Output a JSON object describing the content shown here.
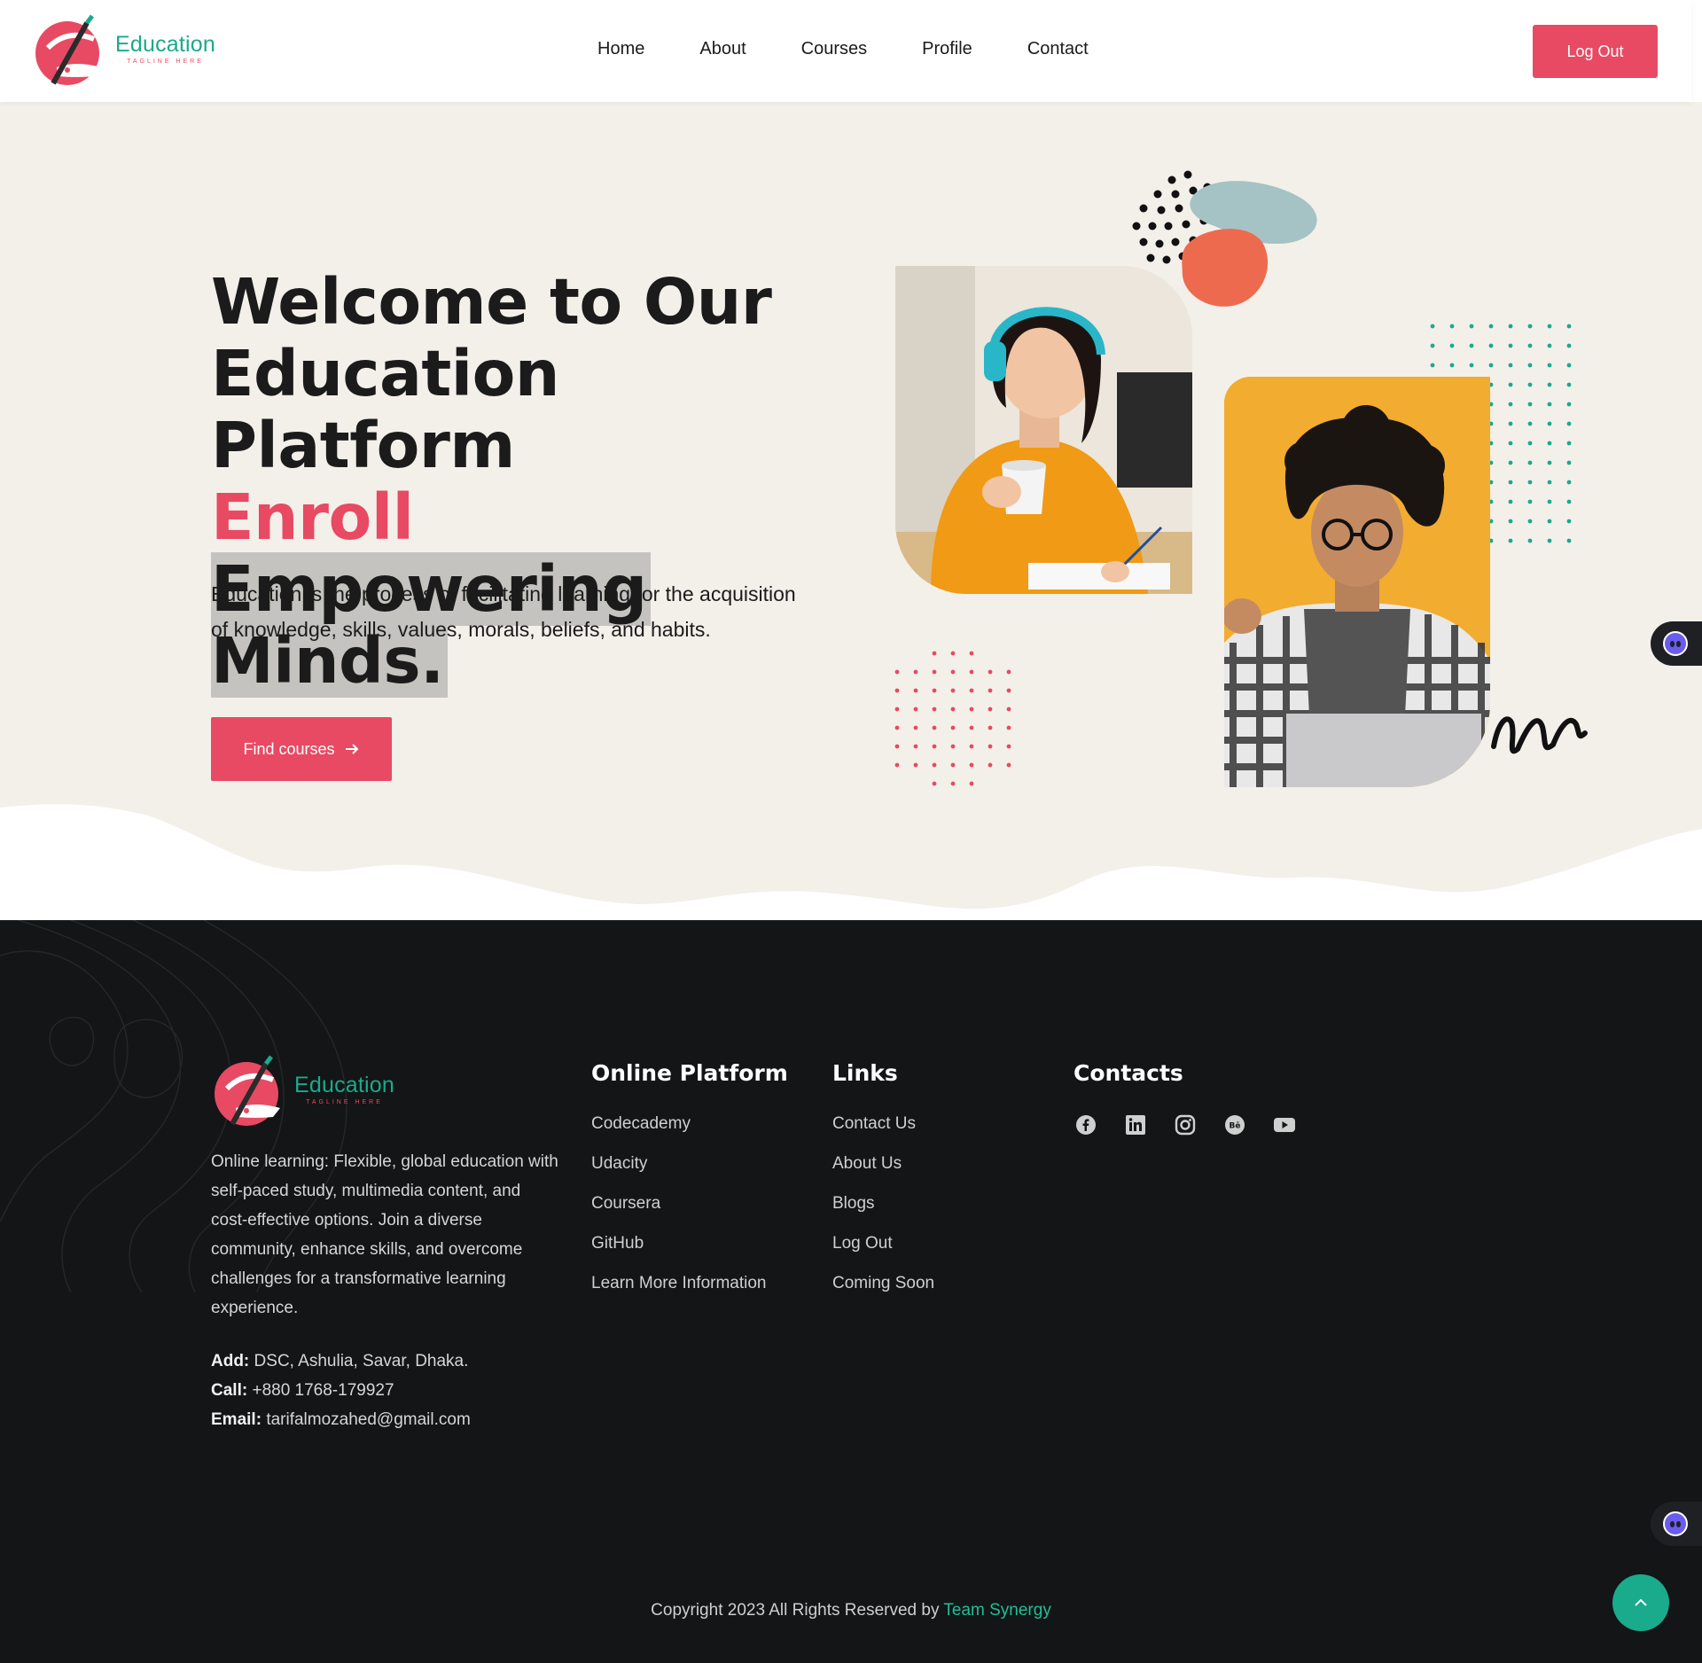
{
  "header": {
    "brand": {
      "name": "Education",
      "tagline": "TAGLINE HERE"
    },
    "nav": [
      {
        "label": "Home"
      },
      {
        "label": "About"
      },
      {
        "label": "Courses"
      },
      {
        "label": "Profile"
      },
      {
        "label": "Contact"
      }
    ],
    "logout_label": "Log Out"
  },
  "hero": {
    "title_line1": "Welcome to Our",
    "title_line2": "Education Platform",
    "title_pink": "Enroll",
    "title_highlight_1": "Empowering",
    "title_highlight_2": "Minds.",
    "description": "Education is the process of facilitating learning, or the acquisition of knowledge, skills, values, morals, beliefs, and habits.",
    "cta_label": "Find courses"
  },
  "footer": {
    "brand": {
      "name": "Education",
      "tagline": "TAGLINE HERE"
    },
    "description": "Online learning: Flexible, global education with self-paced study, multimedia content, and cost-effective options. Join a diverse community, enhance skills, and overcome challenges for a transformative learning experience.",
    "address_label": "Add:",
    "address": "DSC, Ashulia, Savar, Dhaka.",
    "call_label": "Call:",
    "call": "+880 1768-179927",
    "email_label": "Email:",
    "email": "tarifalmozahed@gmail.com",
    "platform_title": "Online Platform",
    "platforms": [
      "Codecademy",
      "Udacity",
      "Coursera",
      "GitHub",
      "Learn More Information"
    ],
    "links_title": "Links",
    "links": [
      "Contact Us",
      "About Us",
      "Blogs",
      "Log Out",
      "Coming Soon"
    ],
    "contacts_title": "Contacts",
    "social_icons": [
      "facebook-icon",
      "linkedin-icon",
      "instagram-icon",
      "behance-icon",
      "youtube-icon"
    ],
    "copyright_text": "Copyright 2023 All Rights Reserved by",
    "copyright_link": "Team Synergy"
  },
  "colors": {
    "accent_pink": "#e84a63",
    "accent_teal": "#1aaa8c",
    "hero_bg": "#f3f0ea",
    "footer_bg": "#131516"
  }
}
